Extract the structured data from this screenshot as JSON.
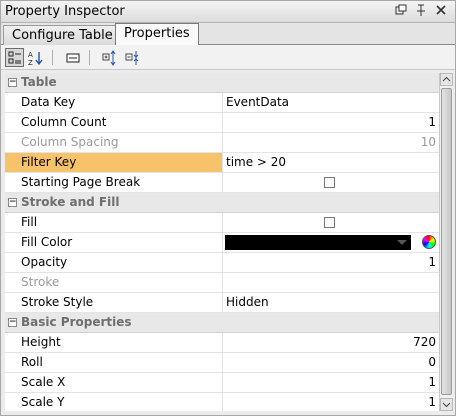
{
  "window": {
    "title": "Property Inspector"
  },
  "tabs": [
    {
      "label": "Configure Table",
      "active": false
    },
    {
      "label": "Properties",
      "active": true
    }
  ],
  "toolbar": {
    "categorized_icon": "categorized-view-icon",
    "alphabetic_icon": "alphabetic-sort-icon",
    "edit_icon": "edit-binding-icon",
    "expand_icon": "expand-all-icon",
    "collapse_icon": "collapse-all-icon"
  },
  "categories": [
    {
      "name": "Table",
      "rows": [
        {
          "name": "Data Key",
          "value": "EventData",
          "type": "text"
        },
        {
          "name": "Column Count",
          "value": "1",
          "type": "number"
        },
        {
          "name": "Column Spacing",
          "value": "10",
          "type": "number",
          "disabled": true
        },
        {
          "name": "Filter Key",
          "value": "time > 20",
          "type": "text",
          "highlight": true
        },
        {
          "name": "Starting Page Break",
          "value": "",
          "type": "checkbox",
          "checked": false
        }
      ]
    },
    {
      "name": "Stroke and Fill",
      "rows": [
        {
          "name": "Fill",
          "value": "",
          "type": "checkbox",
          "checked": false
        },
        {
          "name": "Fill Color",
          "value": "#000000",
          "type": "color"
        },
        {
          "name": "Opacity",
          "value": "1",
          "type": "number"
        },
        {
          "name": "Stroke",
          "value": "",
          "type": "text",
          "disabled": true
        },
        {
          "name": "Stroke Style",
          "value": "Hidden",
          "type": "text"
        }
      ]
    },
    {
      "name": "Basic Properties",
      "rows": [
        {
          "name": "Height",
          "value": "720",
          "type": "number"
        },
        {
          "name": "Roll",
          "value": "0",
          "type": "number"
        },
        {
          "name": "Scale X",
          "value": "1",
          "type": "number"
        },
        {
          "name": "Scale Y",
          "value": "1",
          "type": "number"
        }
      ]
    }
  ],
  "colors": {
    "highlight": "#f6c26a",
    "disabled_text": "#9a9a9a"
  }
}
